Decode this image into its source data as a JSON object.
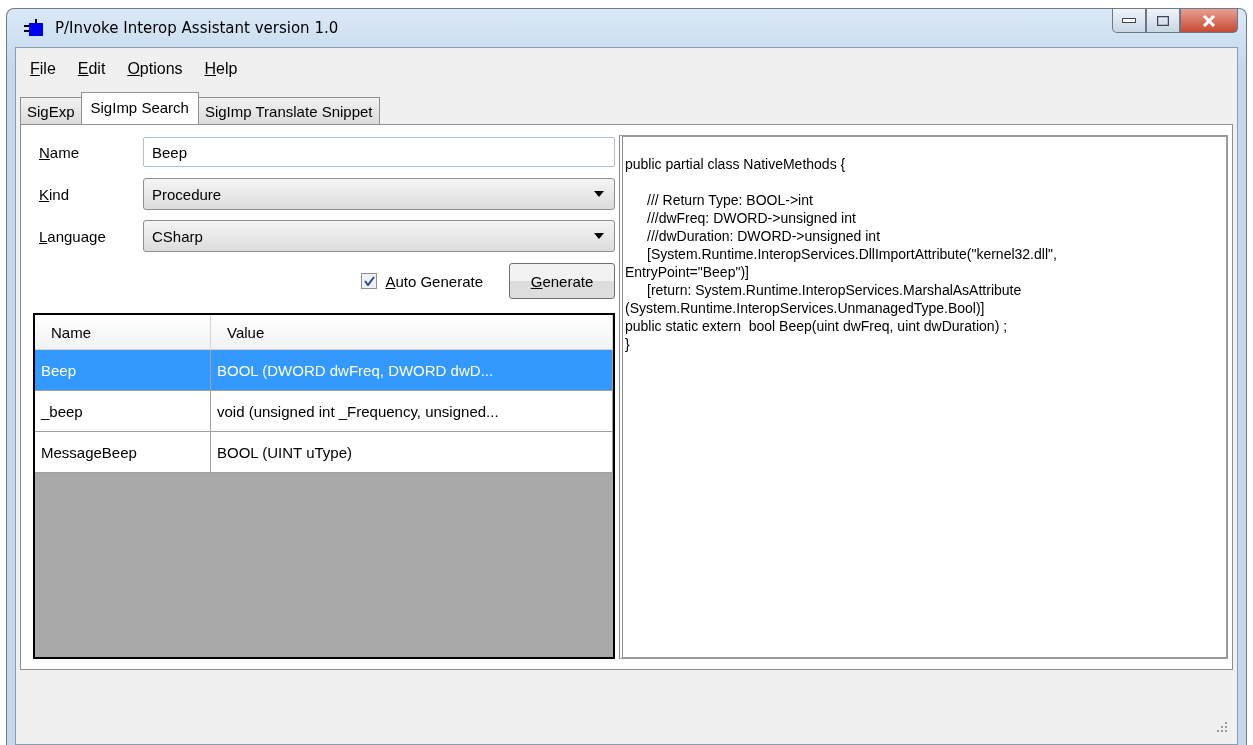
{
  "window": {
    "title": "P/Invoke Interop Assistant version 1.0"
  },
  "menu": [
    "File",
    "Edit",
    "Options",
    "Help"
  ],
  "tabs": [
    {
      "label": "SigExp",
      "selected": false
    },
    {
      "label": "SigImp Search",
      "selected": true
    },
    {
      "label": "SigImp Translate Snippet",
      "selected": false
    }
  ],
  "form": {
    "name": {
      "label": "Name",
      "value": "Beep"
    },
    "kind": {
      "label": "Kind",
      "value": "Procedure"
    },
    "language": {
      "label": "Language",
      "value": "CSharp"
    },
    "auto_generate": {
      "label": "Auto Generate",
      "checked": true
    },
    "generate_button": "Generate"
  },
  "results": {
    "columns": [
      "Name",
      "Value"
    ],
    "rows": [
      {
        "name": "Beep",
        "value": "BOOL (DWORD dwFreq, DWORD dwD...",
        "selected": true
      },
      {
        "name": "_beep",
        "value": "void (unsigned int _Frequency, unsigned...",
        "selected": false
      },
      {
        "name": "MessageBeep",
        "value": "BOOL (UINT uType)",
        "selected": false
      }
    ]
  },
  "code": [
    {
      "text": "public partial class NativeMethods {",
      "indented": false,
      "space_before": false
    },
    {
      "text": "/// Return Type: BOOL->int",
      "indented": true,
      "space_before": true
    },
    {
      "text": "///dwFreq: DWORD->unsigned int",
      "indented": true,
      "space_before": false
    },
    {
      "text": "///dwDuration: DWORD->unsigned int",
      "indented": true,
      "space_before": false
    },
    {
      "text": "[System.Runtime.InteropServices.DllImportAttribute(\"kernel32.dll\",",
      "indented": true,
      "space_before": false
    },
    {
      "text": "EntryPoint=\"Beep\")]",
      "indented": false,
      "space_before": false
    },
    {
      "text": "[return: System.Runtime.InteropServices.MarshalAsAttribute",
      "indented": true,
      "space_before": false
    },
    {
      "text": "(System.Runtime.InteropServices.UnmanagedType.Bool)]",
      "indented": false,
      "space_before": false
    },
    {
      "text": "public static extern  bool Beep(uint dwFreq, uint dwDuration) ;",
      "indented": false,
      "space_before": false
    },
    {
      "text": "}",
      "indented": false,
      "space_before": false
    }
  ]
}
